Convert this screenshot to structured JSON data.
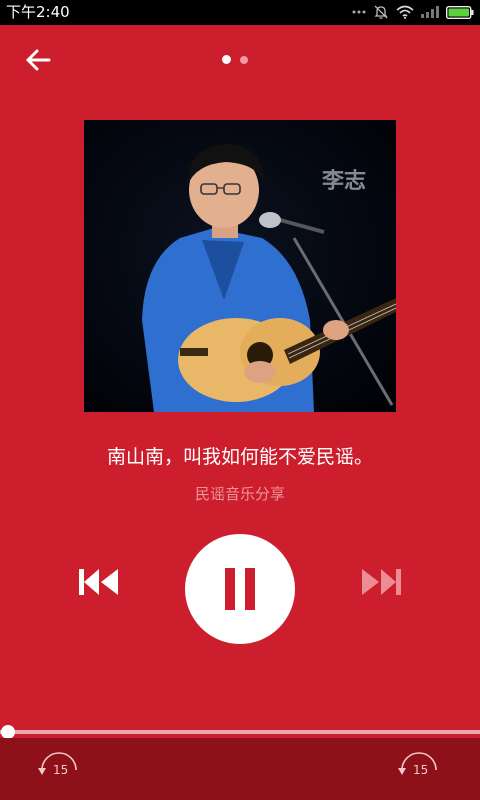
{
  "status_bar": {
    "time": "下午2:40",
    "icons": [
      "more-dots-icon",
      "bell-off-icon",
      "wifi-icon",
      "signal-icon",
      "battery-icon"
    ]
  },
  "header": {
    "back_icon": "back-arrow-icon",
    "pager": {
      "pages": 2,
      "active": 1
    }
  },
  "album": {
    "artwork": "singer-with-acoustic-guitar",
    "banner_text": "李志"
  },
  "track": {
    "title": "南山南，叫我如何能不爱民谣。",
    "subtitle": "民谣音乐分享"
  },
  "controls": {
    "prev_icon": "skip-previous-icon",
    "play_state": "playing",
    "pause_icon": "pause-icon",
    "next_icon": "skip-next-icon"
  },
  "progress": {
    "fraction": 0.0
  },
  "skip": {
    "back_label": "15",
    "forward_label": "15"
  },
  "colors": {
    "background": "#cc1e2c",
    "bottom_bar": "#8e1019",
    "subtitle": "#ee959c",
    "accent_white": "#ffffff"
  }
}
